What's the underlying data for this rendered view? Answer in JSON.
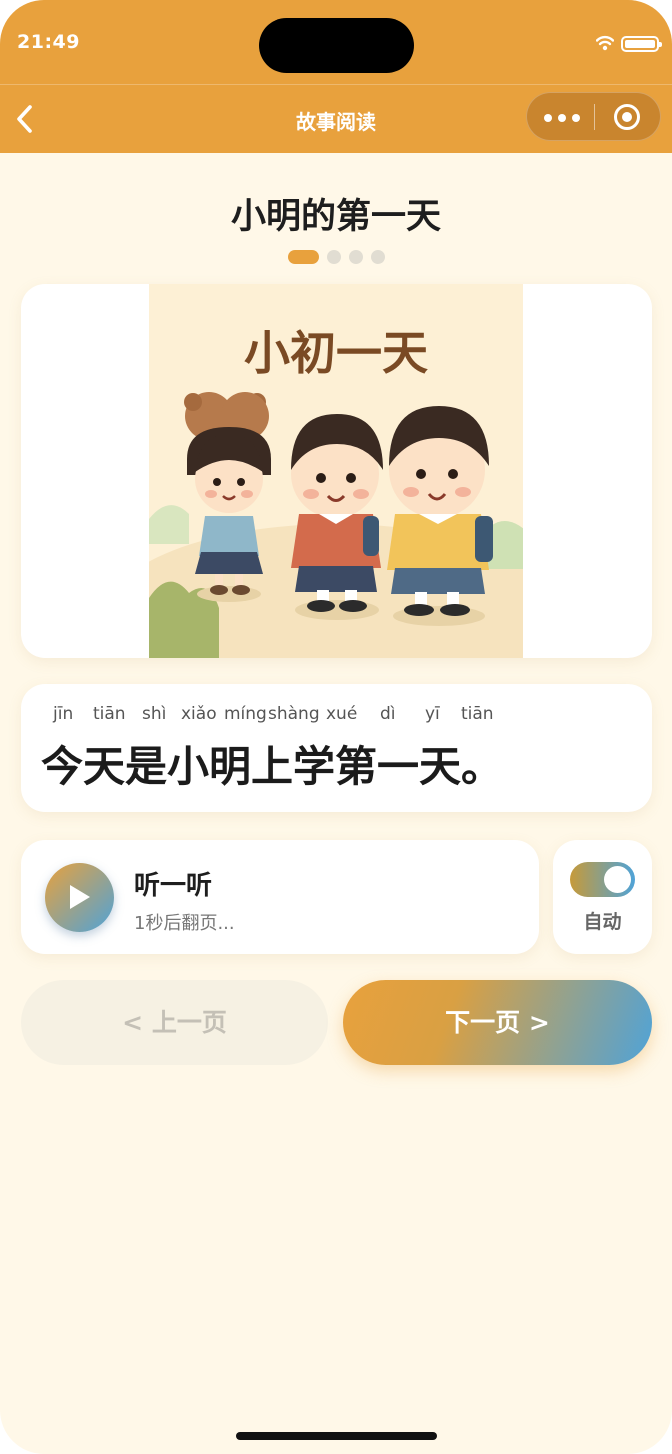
{
  "status_bar": {
    "time": "21:49"
  },
  "nav": {
    "title": "故事阅读"
  },
  "story": {
    "title": "小明的第一天",
    "page_indicator": {
      "current": 1,
      "total": 4
    },
    "illustration": {
      "title_text": "小初一天"
    },
    "pinyin": [
      "jīn",
      "tiān",
      "shì",
      "xiǎo",
      "míng",
      "shàng",
      "xué",
      "dì",
      "yī",
      "tiān"
    ],
    "sentence": "今天是小明上学第一天。"
  },
  "audio": {
    "title": "听一听",
    "subtitle": "1秒后翻页..."
  },
  "auto": {
    "label": "自动",
    "enabled": true
  },
  "buttons": {
    "prev_label": "< 上一页",
    "next_label": "下一页 >"
  },
  "colors": {
    "accent": "#E8A13D",
    "accent_blue": "#4FA3D8",
    "background": "#FFF8E8"
  }
}
